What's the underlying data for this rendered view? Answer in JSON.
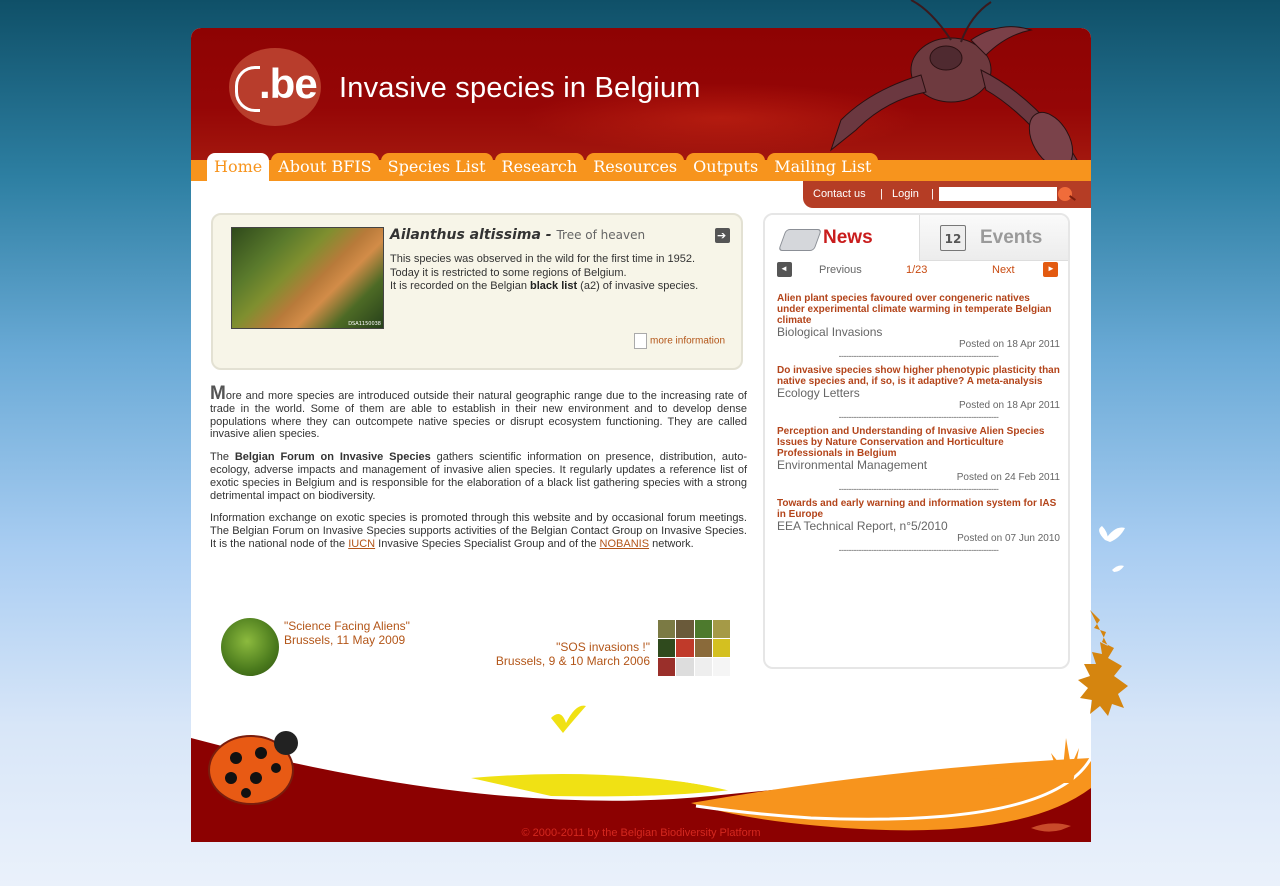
{
  "header": {
    "logo_text": ".be",
    "site_title": "Invasive species in Belgium"
  },
  "nav": {
    "tabs": [
      {
        "label": "Home",
        "active": true
      },
      {
        "label": "About BFIS"
      },
      {
        "label": "Species List"
      },
      {
        "label": "Research"
      },
      {
        "label": "Resources"
      },
      {
        "label": "Outputs"
      },
      {
        "label": "Mailing List"
      }
    ]
  },
  "utility": {
    "contact": "Contact us",
    "separator": "|",
    "login": "Login",
    "search_placeholder": ""
  },
  "feature": {
    "scientific_name": "Ailanthus altissima",
    "dash": " - ",
    "common_name": "Tree of heaven",
    "image_tag": "DSA1150038",
    "line1": "This species was observed in the wild for the first time in 1952.",
    "line2": "Today it is restricted to some regions of Belgium.",
    "line3_prefix": "It is recorded on the Belgian ",
    "line3_bold": "black list",
    "line3_suffix": " (a2) of invasive species.",
    "more_info": "more information"
  },
  "intro": {
    "p1_dropcap": "M",
    "p1_rest": "ore and more species are introduced outside their natural geographic range due to the increasing rate of trade in the world. Some of them are able to establish in their new environment and to develop dense populations where they can outcompete native species or disrupt ecosystem functioning. They are called invasive alien species.",
    "p2_prefix": "The ",
    "p2_bold": "Belgian Forum on Invasive Species",
    "p2_rest": " gathers scientific information on presence, distribution, auto-ecology, adverse impacts and management of invasive alien species. It regularly updates a reference list of exotic species in Belgium and is responsible for the elaboration of a black list gathering species with a strong detrimental impact on biodiversity.",
    "p3_a": "Information exchange on exotic species is promoted through this website and by occasional forum meetings. The Belgian Forum on Invasive Species supports activities of the Belgian Contact Group on Invasive Species. It is the national node of the ",
    "p3_link1": "IUCN",
    "p3_b": " Invasive Species Specialist Group and of the ",
    "p3_link2": "NOBANIS",
    "p3_c": " network."
  },
  "promos": [
    {
      "title": "\"Science Facing Aliens\"",
      "subtitle": "Brussels, 11 May 2009"
    },
    {
      "title": "\"SOS invasions !\"",
      "subtitle": "Brussels, 9 & 10 March 2006"
    }
  ],
  "news_panel": {
    "tab_news": "News",
    "tab_events": "Events",
    "events_icon_text": "12",
    "prev": "Previous",
    "page": "1/23",
    "next": "Next",
    "separator": "----------------------------------------------------------------",
    "items": [
      {
        "title": "Alien plant species favoured over congeneric natives under experimental climate warming in temperate Belgian climate",
        "source": "Biological Invasions",
        "date": "Posted on 18 Apr 2011"
      },
      {
        "title": "Do invasive species show higher phenotypic plasticity than native species and, if so, is it adaptive? A meta-analysis",
        "source": "Ecology Letters",
        "date": "Posted on 18 Apr 2011"
      },
      {
        "title": "Perception and Understanding of Invasive Alien Species Issues by Nature Conservation and Horticulture Professionals in Belgium",
        "source": "Environmental Management",
        "date": "Posted on 24 Feb 2011"
      },
      {
        "title": "Towards and early warning and information system for IAS in Europe",
        "source": "EEA Technical Report, n°5/2010",
        "date": "Posted on 07 Jun 2010"
      }
    ]
  },
  "footer": {
    "copyright": "© 2000-2011 by the Belgian Biodiversity Platform"
  },
  "colors": {
    "header_red": "#8e0303",
    "accent_orange": "#f7941d",
    "link_brown": "#b35619",
    "news_red": "#c91d1d"
  }
}
